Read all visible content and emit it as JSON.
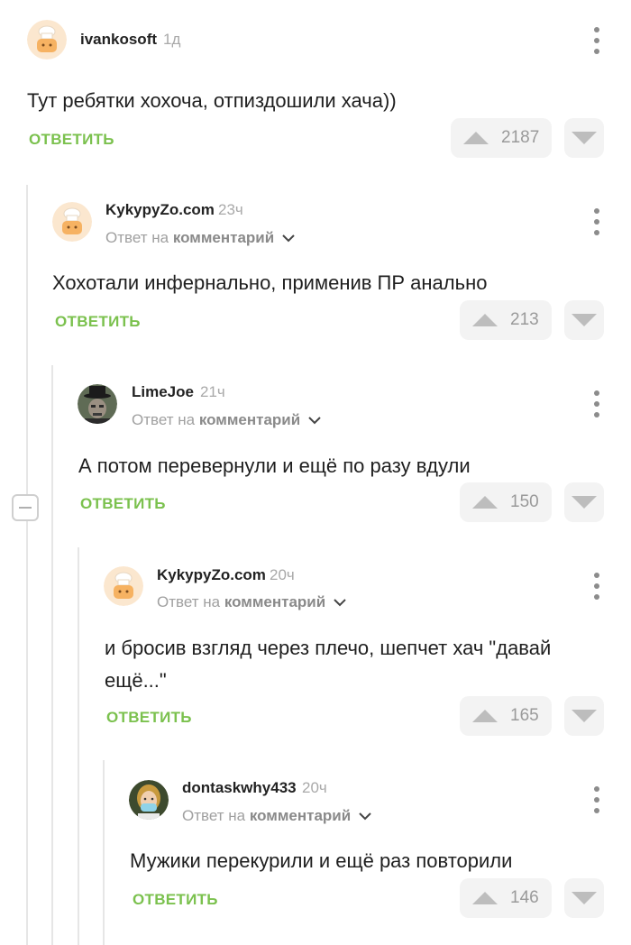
{
  "comments": [
    {
      "username": "ivankosoft",
      "time": "1д",
      "reply_prefix": "",
      "reply_target": "",
      "text": "Тут ребятки хохоча, отпиздошили хача))",
      "reply_label": "ОТВЕТИТЬ",
      "upvotes": "2187",
      "avatar": "baker-default-avatar"
    },
    {
      "username": "KykypyZo.com",
      "time": "23ч",
      "reply_prefix": "Ответ на",
      "reply_target": "комментарий",
      "text": "Хохотали инфернально, применив ПР анально",
      "reply_label": "ОТВЕТИТЬ",
      "upvotes": "213",
      "avatar": "baker-default-avatar"
    },
    {
      "username": "LimeJoe",
      "time": "21ч",
      "reply_prefix": "Ответ на",
      "reply_target": "комментарий",
      "text": "А потом перевернули и ещё по разу вдули",
      "reply_label": "ОТВЕТИТЬ",
      "upvotes": "150",
      "avatar": "top-hat-man-avatar"
    },
    {
      "username": "KykypyZo.com",
      "time": "20ч",
      "reply_prefix": "Ответ на",
      "reply_target": "комментарий",
      "text": "и бросив взгляд через плечо, шепчет хач \"давай ещё...\"",
      "reply_label": "ОТВЕТИТЬ",
      "upvotes": "165",
      "avatar": "baker-default-avatar"
    },
    {
      "username": "dontaskwhy433",
      "time": "20ч",
      "reply_prefix": "Ответ на",
      "reply_target": "комментарий",
      "text": "Мужики перекурили и ещё раз повторили",
      "reply_label": "ОТВЕТИТЬ",
      "upvotes": "146",
      "avatar": "masked-woman-avatar"
    }
  ],
  "colors": {
    "accent": "#7bc14e",
    "vote_bg": "#f3f3f3",
    "muted": "#a9a9a9",
    "thread_line": "#e6e6e6"
  },
  "icons": {
    "upvote": "triangle-up-icon",
    "downvote": "triangle-down-icon",
    "menu": "three-dots-vertical-icon",
    "collapse": "minus-square-icon",
    "expand": "chevron-down-icon"
  }
}
